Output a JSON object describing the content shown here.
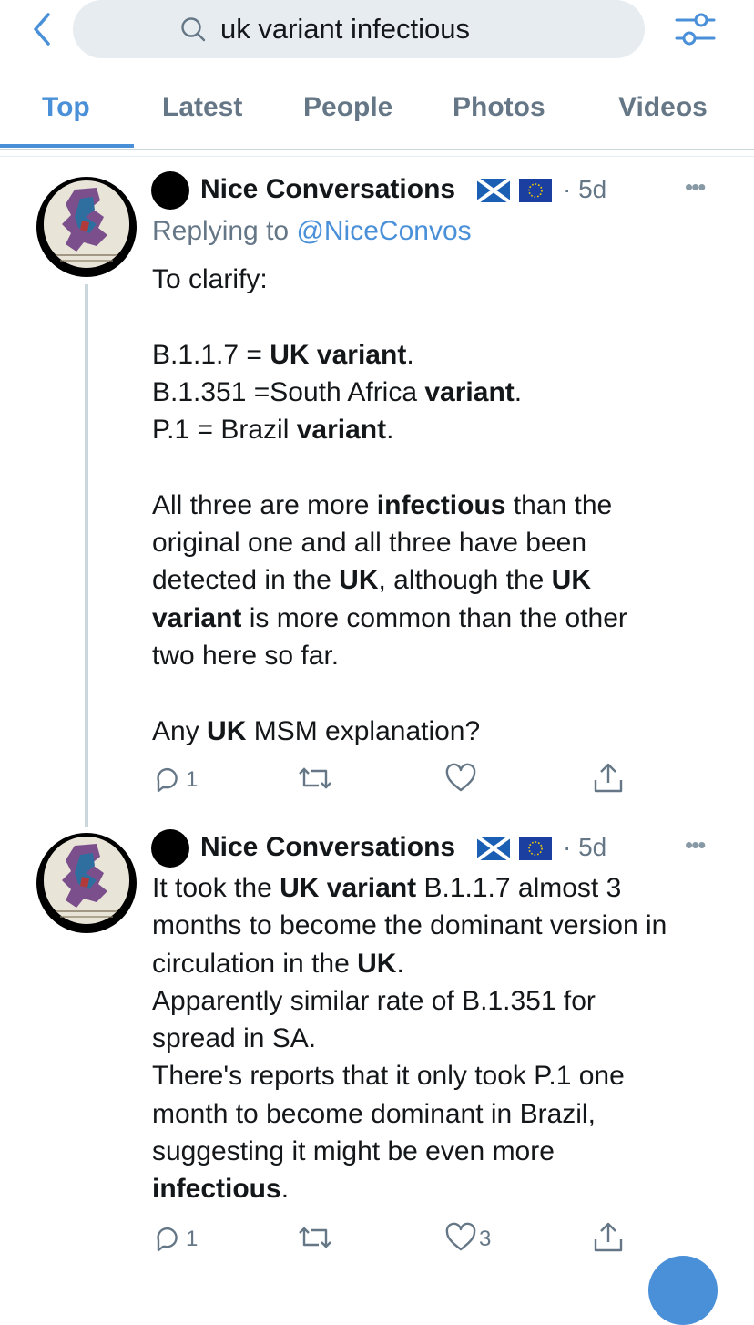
{
  "search": {
    "query": "uk variant infectious"
  },
  "icons": {
    "back": "chevron-left-icon",
    "search": "search-icon",
    "filter": "sliders-icon",
    "reply": "reply-icon",
    "retweet": "retweet-icon",
    "like": "heart-icon",
    "share": "share-icon",
    "more": "more-icon"
  },
  "colors": {
    "accent": "#4a90d9",
    "muted": "#657786",
    "text": "#14171a"
  },
  "tabs": [
    {
      "label": "Top",
      "active": true
    },
    {
      "label": "Latest"
    },
    {
      "label": "People"
    },
    {
      "label": "Photos"
    },
    {
      "label": "Videos"
    }
  ],
  "tweets": [
    {
      "author": "Nice Conversations",
      "age": "5d",
      "more": "•••",
      "replying_prefix": "Replying to ",
      "replying_handle": "@NiceConvos",
      "replies": "1",
      "retweets": "",
      "likes": ""
    },
    {
      "author": "Nice Conversations",
      "age": "5d",
      "more": "•••",
      "replies": "1",
      "retweets": "",
      "likes": "3"
    }
  ],
  "tweet1_text": [
    {
      "t": "To clarify:\n\nB.1.1.7 = ",
      "b": false
    },
    {
      "t": "UK variant",
      "b": true
    },
    {
      "t": ".\nB.1.351 =South Africa ",
      "b": false
    },
    {
      "t": "variant",
      "b": true
    },
    {
      "t": ".\nP.1 = Brazil ",
      "b": false
    },
    {
      "t": "variant",
      "b": true
    },
    {
      "t": ".\n\nAll three are more ",
      "b": false
    },
    {
      "t": "infectious",
      "b": true
    },
    {
      "t": " than the\noriginal one and all three have been\ndetected in the ",
      "b": false
    },
    {
      "t": "UK",
      "b": true
    },
    {
      "t": ", although the ",
      "b": false
    },
    {
      "t": "UK\nvariant",
      "b": true
    },
    {
      "t": " is more common than the other\ntwo here so far.\n\nAny ",
      "b": false
    },
    {
      "t": "UK",
      "b": true
    },
    {
      "t": " MSM explanation?",
      "b": false
    }
  ],
  "tweet2_text": [
    {
      "t": "It took the ",
      "b": false
    },
    {
      "t": "UK variant",
      "b": true
    },
    {
      "t": " B.1.1.7 almost 3\nmonths to become the dominant version in\ncirculation in the ",
      "b": false
    },
    {
      "t": "UK",
      "b": true
    },
    {
      "t": ".\nApparently similar rate of B.1.351 for\nspread in SA.\nThere's reports that it only took P.1 one\nmonth to become dominant in Brazil,\nsuggesting it might be even more\n",
      "b": false
    },
    {
      "t": "infectious",
      "b": true
    },
    {
      "t": ".",
      "b": false
    }
  ]
}
